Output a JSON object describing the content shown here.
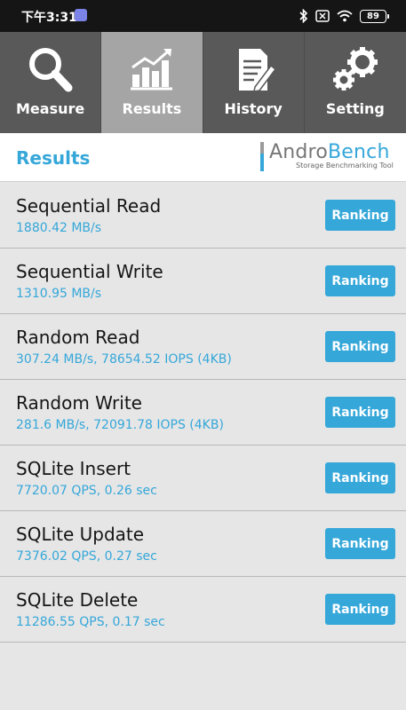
{
  "status_bar": {
    "time": "下午3:31",
    "battery": "89",
    "icons": [
      "app-notification-icon",
      "bluetooth-icon",
      "sim-off-icon",
      "wifi-icon",
      "battery-icon"
    ]
  },
  "tabs": [
    {
      "label": "Measure",
      "icon": "magnifier-icon",
      "active": false
    },
    {
      "label": "Results",
      "icon": "bar-chart-icon",
      "active": true
    },
    {
      "label": "History",
      "icon": "document-pen-icon",
      "active": false
    },
    {
      "label": "Setting",
      "icon": "gears-icon",
      "active": false
    }
  ],
  "header": {
    "title": "Results",
    "logo_part1": "Andro",
    "logo_part2": "Bench",
    "logo_subtitle": "Storage Benchmarking Tool"
  },
  "results": [
    {
      "name": "Sequential Read",
      "value": "1880.42 MB/s",
      "button": "Ranking"
    },
    {
      "name": "Sequential Write",
      "value": "1310.95 MB/s",
      "button": "Ranking"
    },
    {
      "name": "Random Read",
      "value": "307.24 MB/s, 78654.52 IOPS (4KB)",
      "button": "Ranking"
    },
    {
      "name": "Random Write",
      "value": "281.6 MB/s, 72091.78 IOPS (4KB)",
      "button": "Ranking"
    },
    {
      "name": "SQLite Insert",
      "value": "7720.07 QPS, 0.26 sec",
      "button": "Ranking"
    },
    {
      "name": "SQLite Update",
      "value": "7376.02 QPS, 0.27 sec",
      "button": "Ranking"
    },
    {
      "name": "SQLite Delete",
      "value": "11286.55 QPS, 0.17 sec",
      "button": "Ranking"
    }
  ],
  "colors": {
    "accent": "#35a7d9",
    "tab_bar": "#595959",
    "tab_active": "#a5a5a5",
    "background": "#e6e6e6",
    "status_bar": "#151515"
  }
}
